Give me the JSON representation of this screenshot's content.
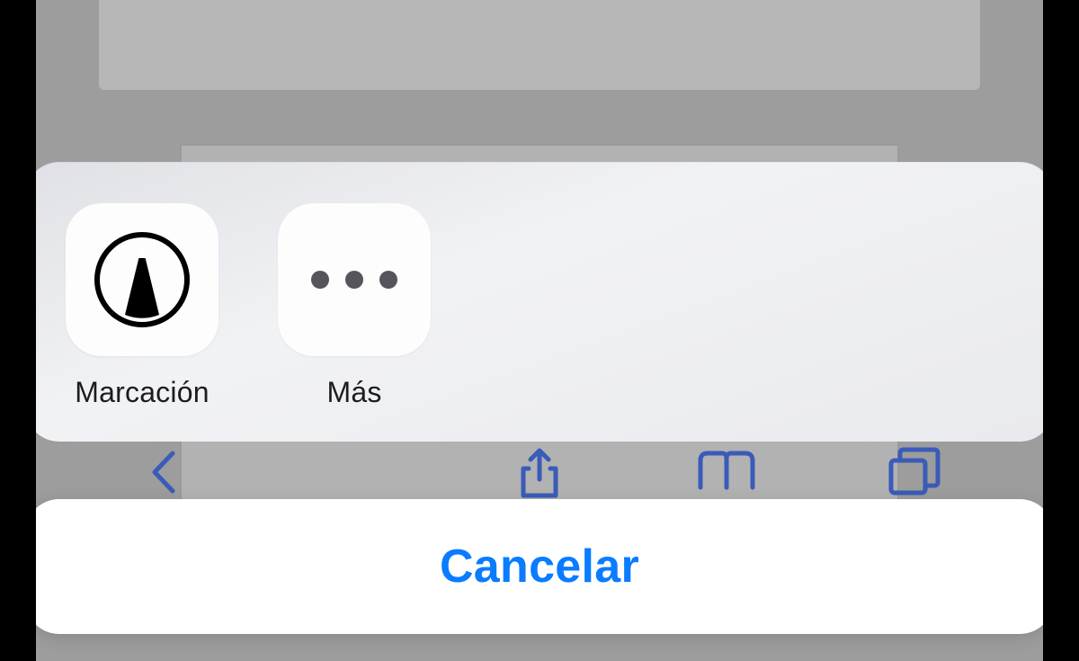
{
  "share_sheet": {
    "actions": [
      {
        "label": "Marcación",
        "icon": "markup-pen-icon"
      },
      {
        "label": "Más",
        "icon": "more-ellipsis-icon"
      }
    ]
  },
  "cancel": {
    "label": "Cancelar"
  }
}
